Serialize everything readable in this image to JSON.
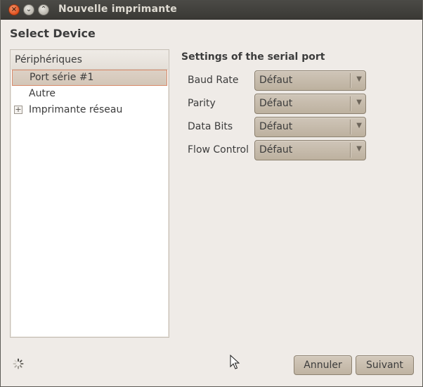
{
  "window": {
    "title": "Nouvelle imprimante",
    "controls": {
      "close": "×",
      "minimize": "⌄",
      "maximize": "⌃"
    }
  },
  "header": {
    "title": "Select Device"
  },
  "device_list": {
    "header": "Périphériques",
    "items": [
      {
        "label": "Port série #1",
        "selected": true,
        "expander": ""
      },
      {
        "label": "Autre",
        "selected": false,
        "expander": ""
      },
      {
        "label": "Imprimante réseau",
        "selected": false,
        "expander": "+"
      }
    ]
  },
  "serial_settings": {
    "title": "Settings of the serial port",
    "fields": [
      {
        "label": "Baud Rate",
        "value": "Défaut"
      },
      {
        "label": "Parity",
        "value": "Défaut"
      },
      {
        "label": "Data Bits",
        "value": "Défaut"
      },
      {
        "label": "Flow Control",
        "value": "Défaut"
      }
    ],
    "dropdown_arrow": "▼"
  },
  "buttons": {
    "cancel": "Annuler",
    "next": "Suivant"
  },
  "icons": {
    "close": "close-icon",
    "minimize": "minimize-icon",
    "maximize": "maximize-icon",
    "spinner": "spinner-icon",
    "cursor": "mouse-pointer-icon"
  },
  "colors": {
    "selection_border": "#d98a6a",
    "titlebar": "#3a3935",
    "window_bg": "#efebe7"
  }
}
